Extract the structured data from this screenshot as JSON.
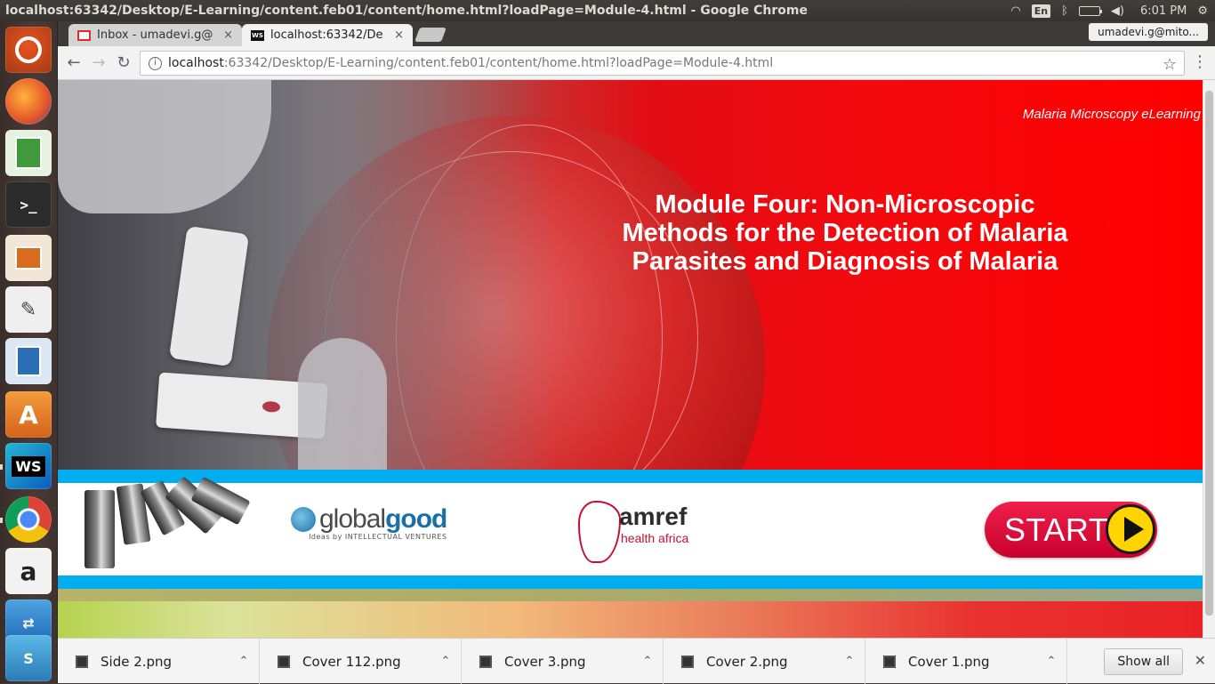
{
  "window": {
    "title": "localhost:63342/Desktop/E-Learning/content.feb01/content/home.html?loadPage=Module-4.html - Google Chrome"
  },
  "panel": {
    "lang": "En",
    "clock": "6:01 PM"
  },
  "tabs": [
    {
      "label": "Inbox - umadevi.g@",
      "close": "×"
    },
    {
      "label": "localhost:63342/De",
      "close": "×"
    }
  ],
  "profile": {
    "name": "umadevi.g@mito..."
  },
  "omnibox": {
    "host": "localhost",
    "rest": ":63342/Desktop/E-Learning/content.feb01/content/home.html?loadPage=Module-4.html"
  },
  "page": {
    "brand": "Malaria Microscopy eLearning",
    "module_title": "Module Four: Non-Microscopic Methods for the Detection of Malaria Parasites and Diagnosis of Malaria",
    "logos": {
      "globalgood_1": "global",
      "globalgood_2": "good",
      "globalgood_sub": "Ideas by INTELLECTUAL VENTURES",
      "amref_name": "amref",
      "amref_sub": "health africa"
    },
    "start_label": "START"
  },
  "downloads": {
    "items": [
      {
        "name": "Side 2.png"
      },
      {
        "name": "Cover 112.png"
      },
      {
        "name": "Cover 3.png"
      },
      {
        "name": "Cover 2.png"
      },
      {
        "name": "Cover 1.png"
      }
    ],
    "show_all": "Show all"
  },
  "colors": {
    "hero_red": "#ff0000",
    "band_blue": "#00aeef",
    "start_button": "#e01040",
    "ubuntu_orange": "#e95420"
  },
  "icons": {
    "launcher": [
      "ubuntu-logo-icon",
      "firefox-icon",
      "libreoffice-calc-icon",
      "terminal-icon",
      "libreoffice-impress-icon",
      "text-editor-icon",
      "libreoffice-writer-icon",
      "software-center-icon",
      "webstorm-icon",
      "chrome-icon",
      "amazon-icon"
    ]
  }
}
